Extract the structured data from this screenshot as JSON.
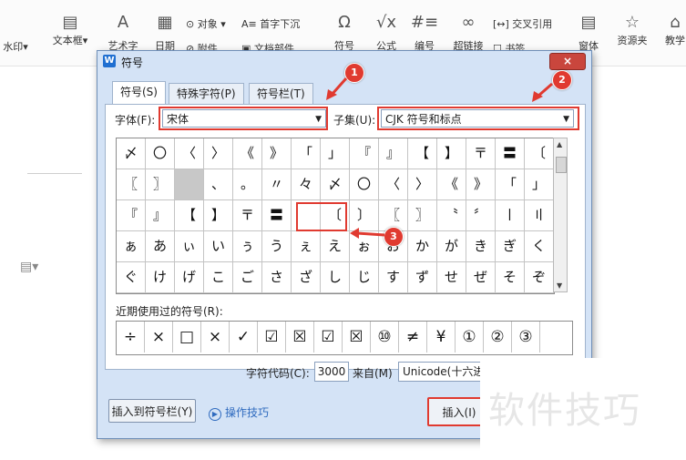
{
  "ribbon": {
    "watermark": "水印",
    "textbox": "文本框",
    "art": "艺术字",
    "date": "日期",
    "object": "对象",
    "attach": "附件",
    "dropcap": "首字下沉",
    "docpart": "文档部件",
    "symbol": "符号",
    "formula": "公式",
    "numbering": "编号",
    "hyperlink": "超链接",
    "crossref": "交叉引用",
    "bookmark": "书签",
    "window": "窗体",
    "resources": "资源夹",
    "teach": "教学"
  },
  "dialog": {
    "title": "符号",
    "close": "×",
    "tabs": [
      "符号(S)",
      "特殊字符(P)",
      "符号栏(T)"
    ],
    "font_label": "字体(F):",
    "font_value": "宋体",
    "subset_label": "子集(U):",
    "subset_value": "CJK 符号和标点",
    "grid_rows": [
      [
        "〆",
        "〇",
        "〈",
        "〉",
        "《",
        "》",
        "「",
        "」",
        "『",
        "』",
        "【",
        "】",
        "〒",
        "〓",
        "〔"
      ],
      [
        "〖",
        "〗",
        "",
        "、",
        "。",
        "〃",
        "々",
        "〆",
        "〇",
        "〈",
        "〉",
        "《",
        "》",
        "「",
        "」"
      ],
      [
        "『",
        "』",
        "【",
        "】",
        "〒",
        "〓",
        "",
        "〔",
        "〕",
        "〖",
        "〗",
        "〝",
        "〞",
        "〡",
        "〢"
      ],
      [
        "ぁ",
        "あ",
        "ぃ",
        "い",
        "ぅ",
        "う",
        "ぇ",
        "え",
        "ぉ",
        "お",
        "か",
        "が",
        "き",
        "ぎ",
        "く"
      ],
      [
        "ぐ",
        "け",
        "げ",
        "こ",
        "ご",
        "さ",
        "ざ",
        "し",
        "じ",
        "す",
        "ず",
        "せ",
        "ぜ",
        "そ",
        "ぞ"
      ]
    ],
    "recent_label": "近期使用过的符号(R):",
    "recent": [
      "÷",
      "×",
      "□",
      "×",
      "✓",
      "☑",
      "☒",
      "☑",
      "☒",
      "⑩",
      "≠",
      "¥",
      "①",
      "②",
      "③"
    ],
    "code_label": "字符代码(C):",
    "code_value": "3000",
    "from_label": "来自(M)",
    "from_value": "Unicode(十六进",
    "add_to_bar": "插入到符号栏(Y)",
    "tips": "操作技巧",
    "insert": "插入(I)"
  },
  "annotations": [
    "1",
    "2",
    "3"
  ],
  "watermark_text": "软件技巧",
  "colors": {
    "annotation_red": "#e03a30",
    "dialog_bg": "#d4e3f6",
    "accent_blue": "#2f6bbf"
  }
}
